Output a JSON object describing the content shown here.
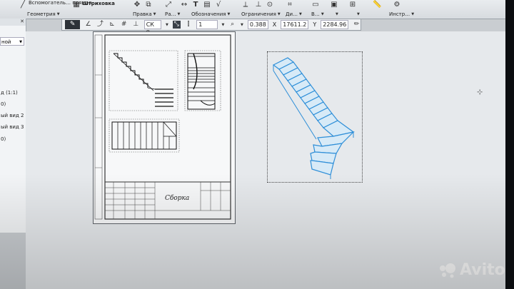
{
  "ribbon": {
    "top_items": [
      "Вспомогатель… прямая",
      "Штриховка"
    ],
    "groups": [
      {
        "name": "geometry",
        "label": "Геометрия"
      },
      {
        "name": "edit",
        "label": "Правка"
      },
      {
        "name": "ra",
        "label": "Ра…"
      },
      {
        "name": "annotations",
        "label": "Обозначения"
      },
      {
        "name": "constraints",
        "label": "Ограничения"
      },
      {
        "name": "di",
        "label": "Ди…"
      },
      {
        "name": "v",
        "label": "В…"
      },
      {
        "name": "instr",
        "label": "Инстр…"
      }
    ]
  },
  "propbar": {
    "cs": "СК 0",
    "layer": "1",
    "zoom": "0.388",
    "x_label": "X",
    "x_value": "17611.2",
    "y_label": "Y",
    "y_value": "2284.96"
  },
  "left_panel": {
    "dropdown": "ной",
    "items": [
      "д (1:1)",
      "0)",
      "ый вид 2 (1",
      "ый вид 3 (1",
      "0)"
    ]
  },
  "drawing": {
    "title_block_name": "Сборка"
  },
  "watermark": {
    "text": "Avito"
  }
}
